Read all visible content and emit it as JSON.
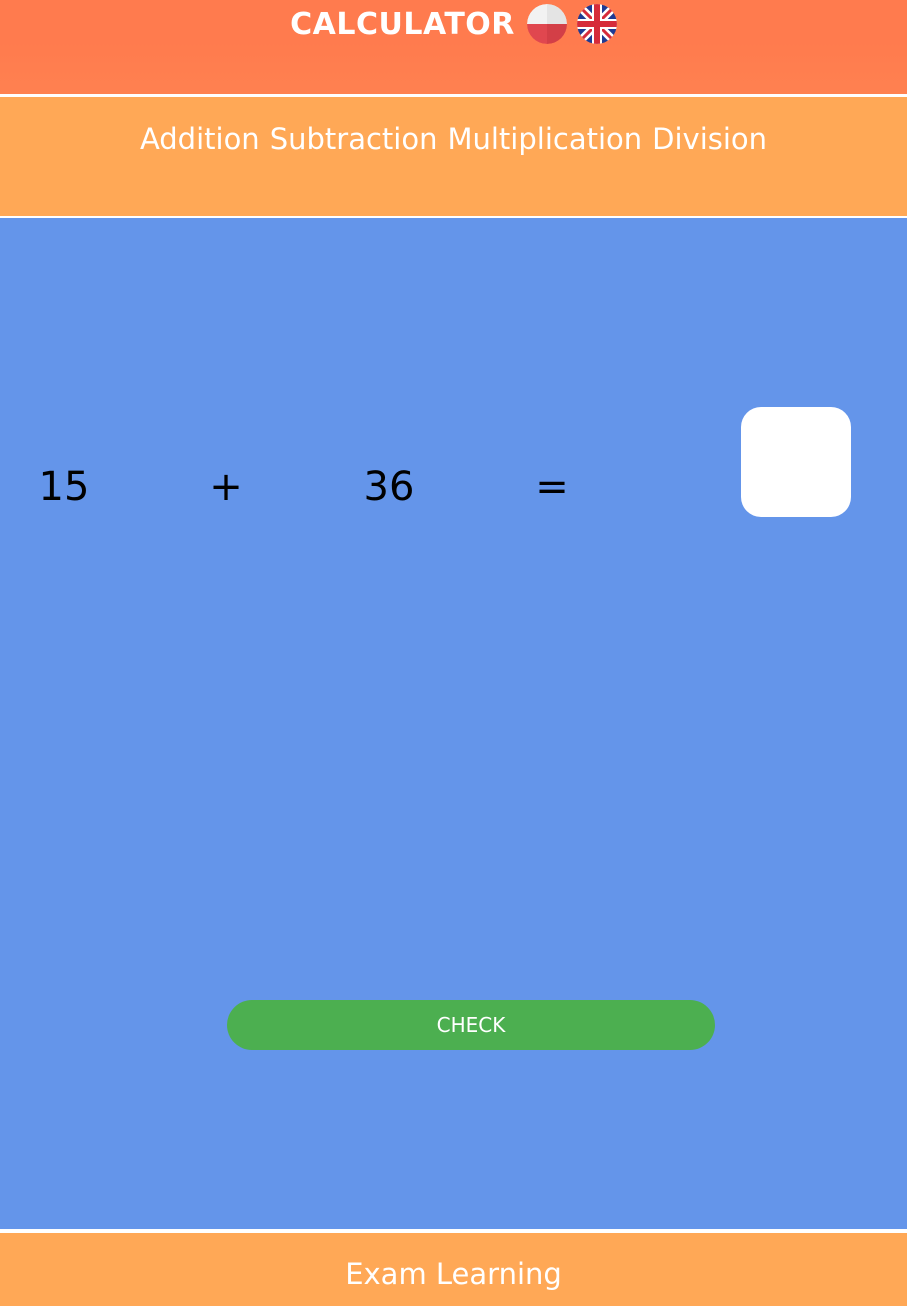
{
  "header": {
    "title": "CALCULATOR",
    "flags": [
      {
        "name": "poland-flag-icon"
      },
      {
        "name": "uk-flag-icon"
      }
    ]
  },
  "nav": {
    "items": [
      {
        "label": "Addition"
      },
      {
        "label": "Subtraction"
      },
      {
        "label": "Multiplication"
      },
      {
        "label": "Division"
      }
    ]
  },
  "equation": {
    "operand1": "15",
    "operator": "+",
    "operand2": "36",
    "equals": "=",
    "answer_value": ""
  },
  "actions": {
    "check_label": "CHECK"
  },
  "footer": {
    "text": "Exam Learning"
  },
  "colors": {
    "header_bg": "#ff7b4e",
    "nav_bg": "#ffa856",
    "main_bg": "#6495ea",
    "check_button": "#4caf50",
    "footer_bg": "#ffa856"
  }
}
